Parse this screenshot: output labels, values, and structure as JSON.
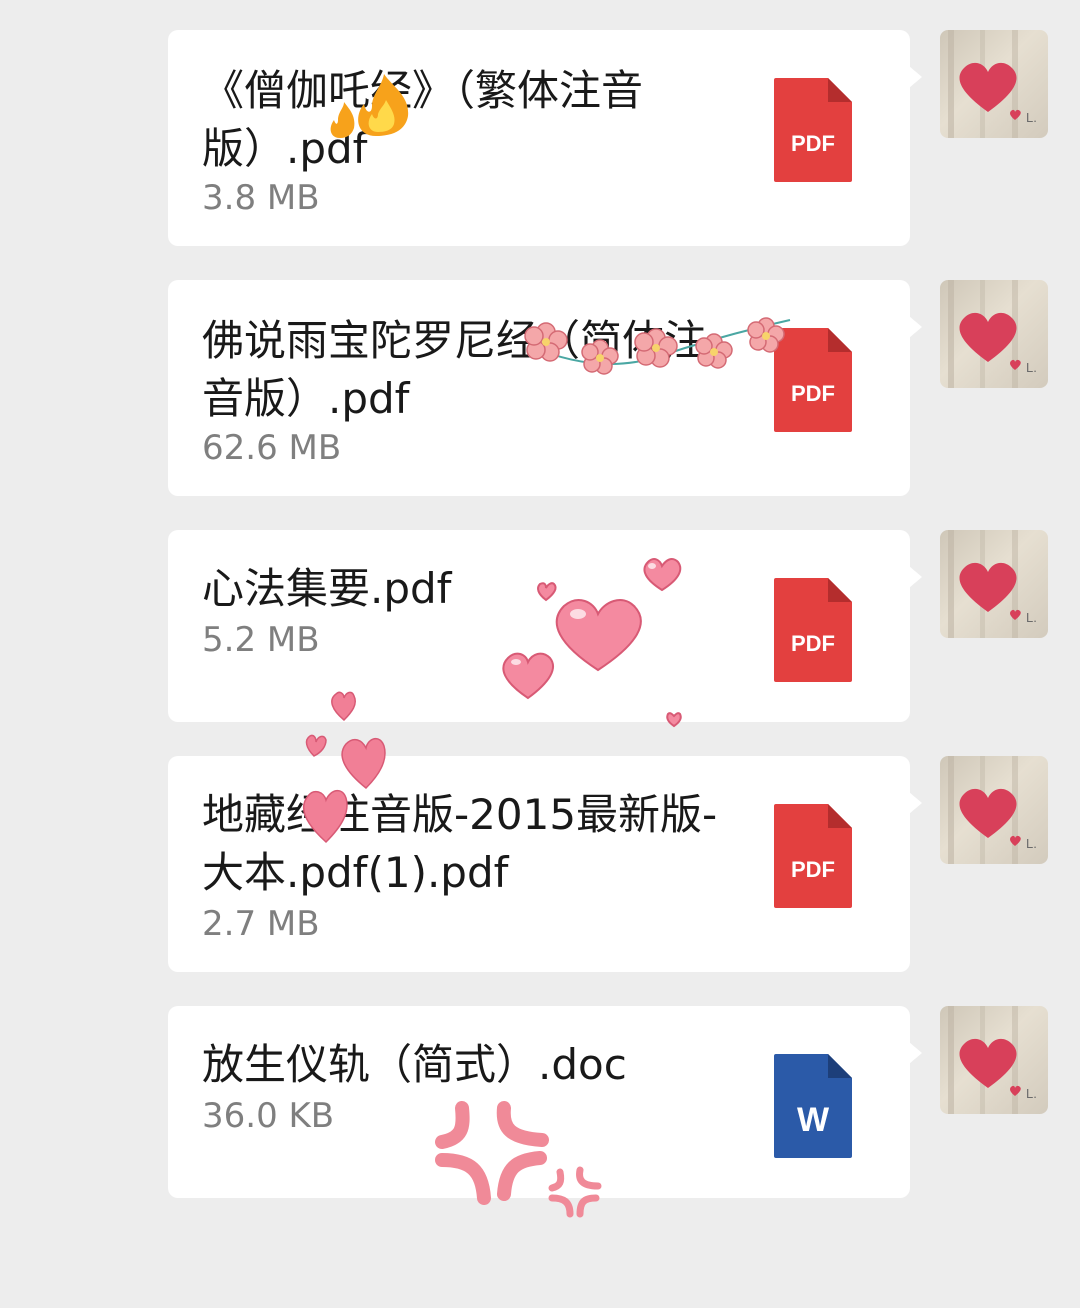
{
  "messages": [
    {
      "name": "《僧伽吒经》（繁体注音版）.pdf",
      "size": "3.8 MB",
      "type": "PDF"
    },
    {
      "name": "佛说雨宝陀罗尼经（简体注音版）.pdf",
      "size": "62.6 MB",
      "type": "PDF"
    },
    {
      "name": "心法集要.pdf",
      "size": "5.2 MB",
      "type": "PDF"
    },
    {
      "name": "地藏经注音版-2015最新版-大本.pdf(1).pdf",
      "size": "2.7 MB",
      "type": "PDF"
    },
    {
      "name": "放生仪轨（简式）.doc",
      "size": "36.0 KB",
      "type": "W"
    }
  ],
  "avatar": {
    "label": "L."
  },
  "colors": {
    "pdf": "#e3403f",
    "word": "#2b5aa8",
    "heart": "#d8405a",
    "bg": "#ededed"
  },
  "icons": {
    "pdf": "pdf-file-icon",
    "word": "word-file-icon",
    "avatar": "heart-avatar"
  }
}
